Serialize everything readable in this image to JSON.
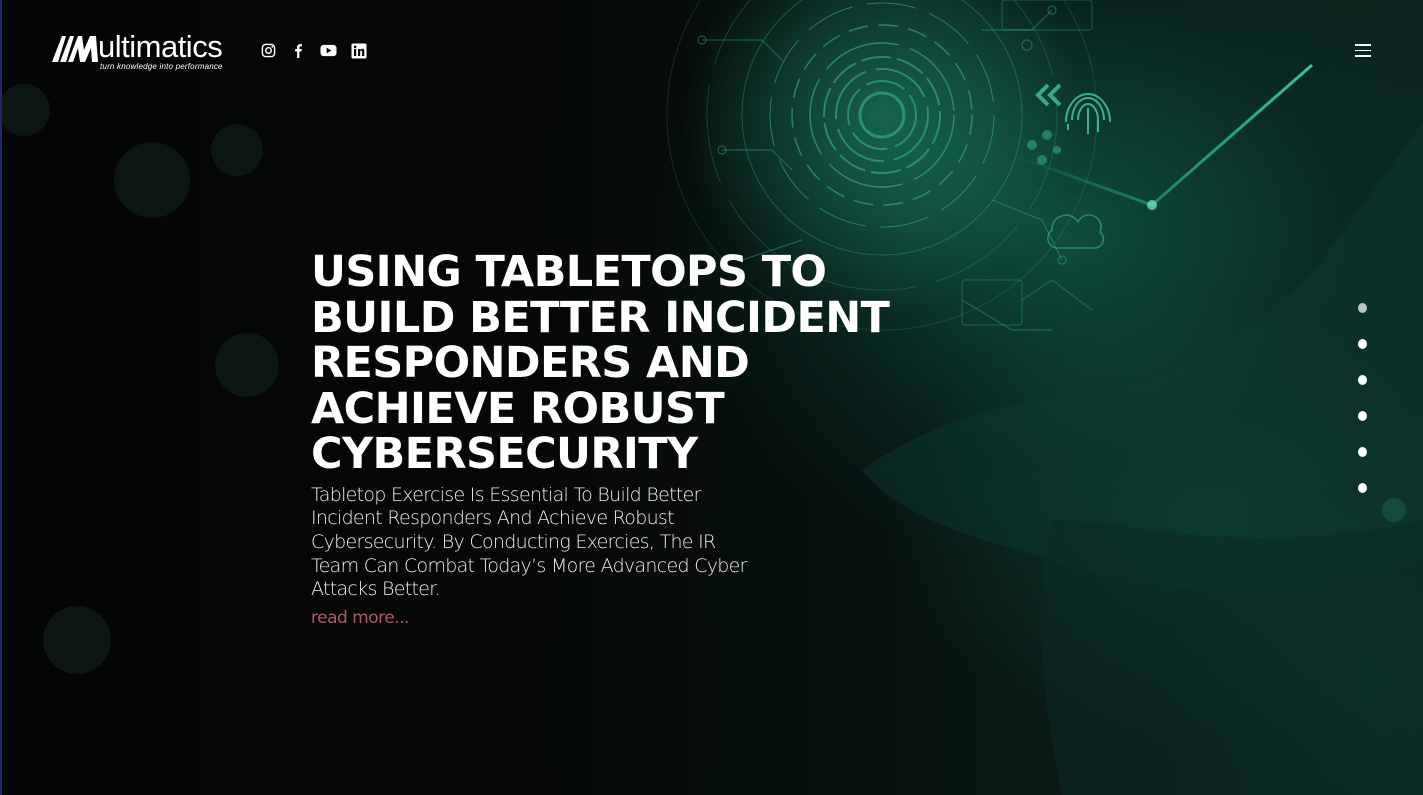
{
  "brand": {
    "name": "ultimatics",
    "tagline": "turn knowledge into performance"
  },
  "social": [
    {
      "icon": "instagram-icon"
    },
    {
      "icon": "facebook-icon"
    },
    {
      "icon": "youtube-icon"
    },
    {
      "icon": "linkedin-icon"
    }
  ],
  "hero": {
    "title": "USING TABLETOPS TO BUILD BETTER INCIDENT RESPONDERS AND ACHIEVE ROBUST CYBERSECURITY",
    "description": "Tabletop Exercise Is Essential To Build Better Incident Responders And Achieve Robust Cybersecurity. By Conducting Exercies, The IR Team Can Combat Today’s More Advanced Cyber Attacks Better.",
    "link": "read more..."
  },
  "slider": {
    "count": 6,
    "active": 1
  },
  "colors": {
    "accent_link": "#b0547c",
    "glow": "#12785f"
  }
}
